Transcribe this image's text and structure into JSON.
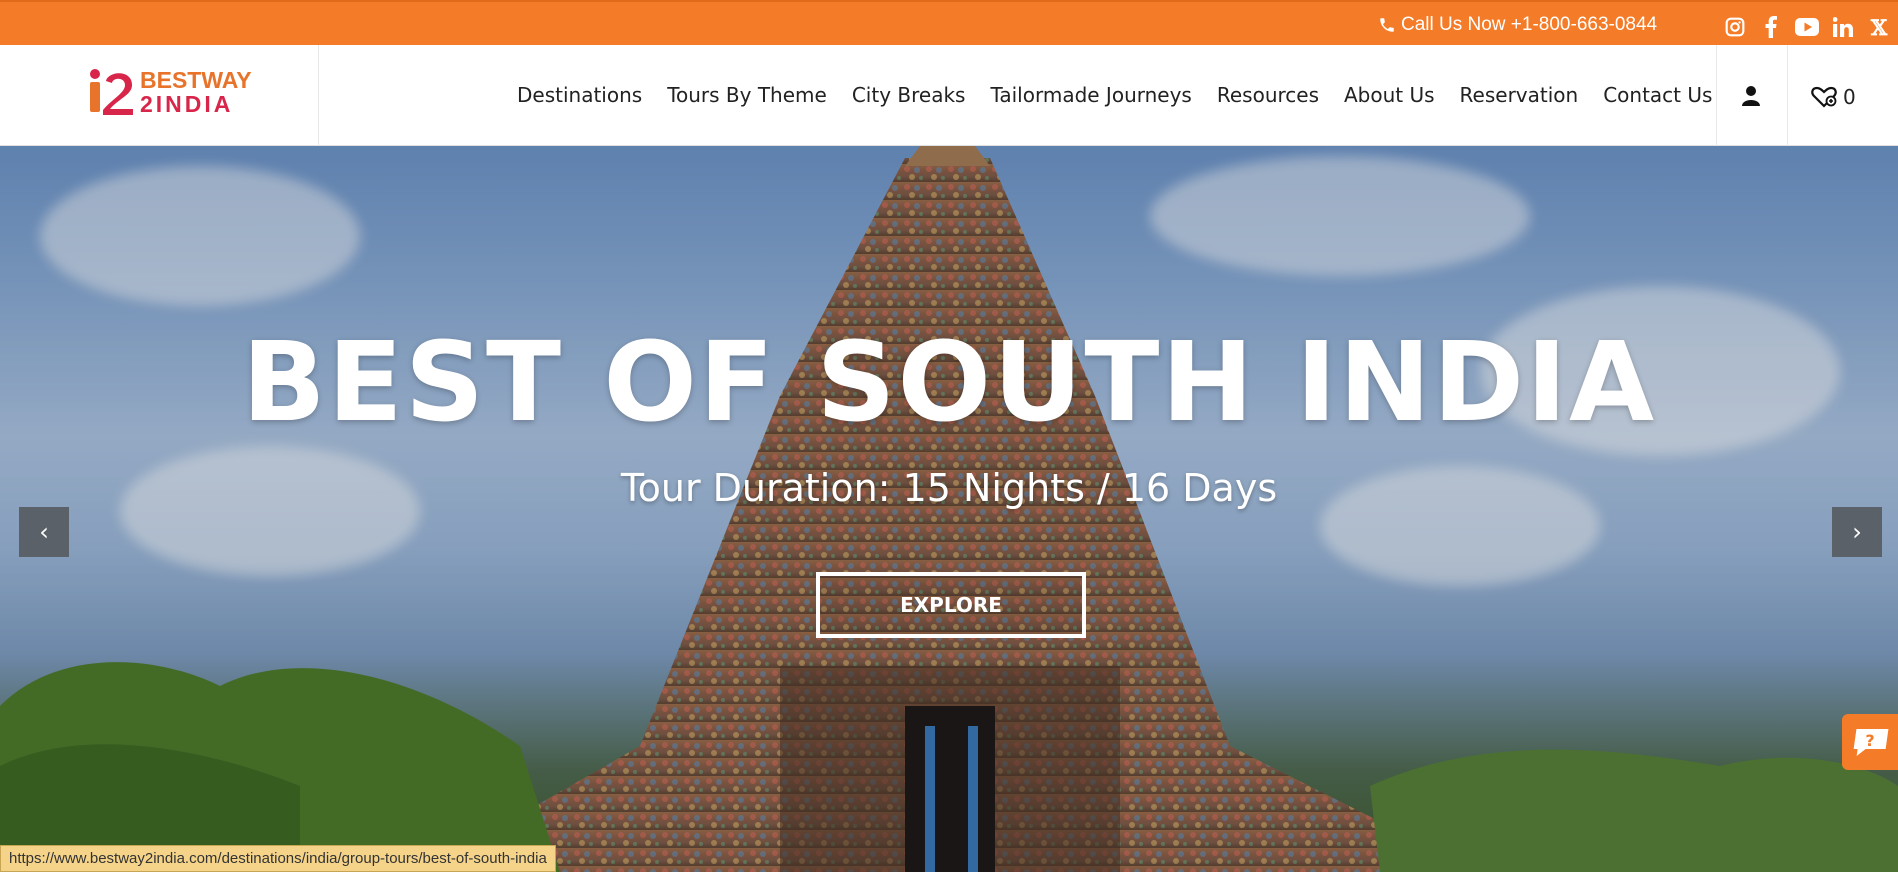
{
  "topbar": {
    "call_text": "Call Us Now +1-800-663-0844",
    "social_icons": [
      "instagram-icon",
      "facebook-icon",
      "youtube-icon",
      "linkedin-icon",
      "x-icon"
    ],
    "x_glyph": "𝕏",
    "bg_color": "#f47b27"
  },
  "logo": {
    "line1": "BESTWAY",
    "line2": "2INDIA"
  },
  "nav": {
    "items": [
      "Destinations",
      "Tours By Theme",
      "City Breaks",
      "Tailormade Journeys",
      "Resources",
      "About Us",
      "Reservation",
      "Contact Us"
    ],
    "wishlist_count": "0"
  },
  "hero": {
    "title": "BEST OF SOUTH INDIA",
    "subtitle": "Tour Duration: 15 Nights / 16 Days",
    "button": "EXPLORE",
    "prev": "‹",
    "next": "›"
  },
  "status_url": "https://www.bestway2india.com/destinations/india/group-tours/best-of-south-india"
}
